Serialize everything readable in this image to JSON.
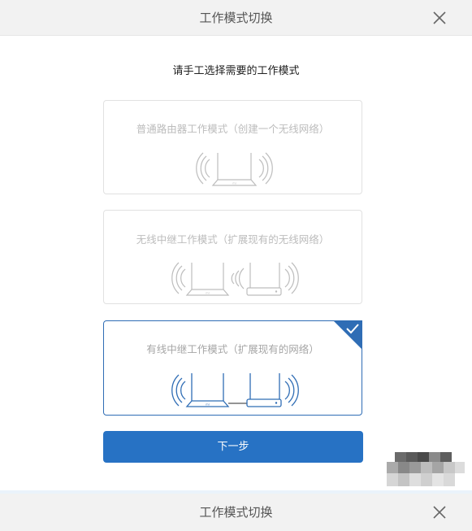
{
  "dialog": {
    "title": "工作模式切换",
    "subtitle": "请手工选择需要的工作模式"
  },
  "modes": [
    {
      "label": "普通路由器工作模式（创建一个无线网络）",
      "selected": false
    },
    {
      "label": "无线中继工作模式（扩展现有的无线网络）",
      "selected": false
    },
    {
      "label": "有线中继工作模式（扩展现有的网络）",
      "selected": true
    }
  ],
  "next_button": {
    "label": "下一步"
  },
  "footer_dialog": {
    "title": "工作模式切换"
  },
  "colors": {
    "accent": "#2772c4",
    "selected_border": "#2f6db5",
    "header_bg": "#f2f2f2",
    "icon_gray": "#bdbdbd",
    "icon_dark": "#7a7a7a"
  },
  "icons": [
    "close-icon",
    "check-icon",
    "router-icon",
    "wifi-signal-icon",
    "repeater-icon",
    "cable-icon"
  ]
}
